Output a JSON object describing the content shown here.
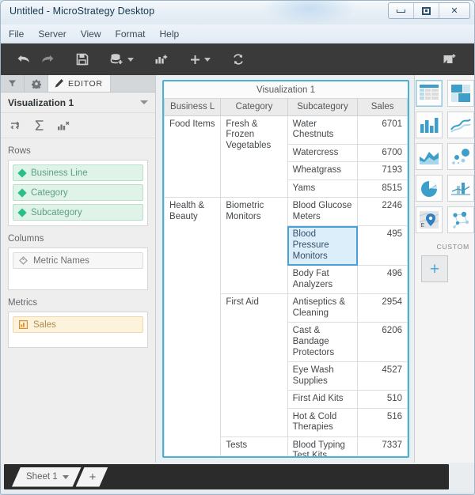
{
  "window": {
    "title": "Untitled - MicroStrategy Desktop",
    "controls": {
      "minimize": "minimize-icon",
      "restore": "restore-icon",
      "close": "✕"
    }
  },
  "menubar": {
    "items": [
      {
        "label": "File"
      },
      {
        "label": "Server"
      },
      {
        "label": "View"
      },
      {
        "label": "Format"
      },
      {
        "label": "Help"
      }
    ]
  },
  "toolbar": {
    "buttons": [
      {
        "name": "undo-icon",
        "glyph": "↰"
      },
      {
        "name": "redo-icon",
        "glyph": "↱"
      },
      {
        "name": "save-icon",
        "glyph": "save"
      },
      {
        "name": "add-data-icon",
        "glyph": "data",
        "has_caret": true
      },
      {
        "name": "add-visualization-icon",
        "glyph": "chart"
      },
      {
        "name": "add-icon",
        "glyph": "+",
        "has_caret": true
      },
      {
        "name": "refresh-icon",
        "glyph": "refresh"
      }
    ],
    "right_button": {
      "name": "add-panel-icon"
    }
  },
  "editor": {
    "tabs": [
      {
        "name": "filters-tab",
        "icon": "filter-icon",
        "label": ""
      },
      {
        "name": "properties-tab",
        "icon": "gear-icon",
        "label": ""
      },
      {
        "name": "editor-tab",
        "icon": "pencil-icon",
        "label": "EDITOR",
        "active": true
      }
    ],
    "visualization_name": "Visualization 1",
    "tools": [
      {
        "name": "swap-rows-columns-icon",
        "glyph": "swap"
      },
      {
        "name": "totals-icon",
        "glyph": "Σ"
      },
      {
        "name": "remove-all-icon",
        "glyph": "chart-x"
      }
    ],
    "zones": [
      {
        "name": "rows-zone",
        "label": "Rows",
        "items": [
          {
            "label": "Business Line",
            "kind": "attribute"
          },
          {
            "label": "Category",
            "kind": "attribute"
          },
          {
            "label": "Subcategory",
            "kind": "attribute"
          }
        ]
      },
      {
        "name": "columns-zone",
        "label": "Columns",
        "items": [
          {
            "label": "Metric Names",
            "kind": "neutral"
          }
        ]
      },
      {
        "name": "metrics-zone",
        "label": "Metrics",
        "items": [
          {
            "label": "Sales",
            "kind": "metric"
          }
        ]
      }
    ]
  },
  "visualization": {
    "title": "Visualization 1",
    "columns": [
      {
        "key": "business_line",
        "label": "Business L"
      },
      {
        "key": "category",
        "label": "Category"
      },
      {
        "key": "subcategory",
        "label": "Subcategory"
      },
      {
        "key": "sales",
        "label": "Sales"
      }
    ],
    "rows": [
      {
        "business_line": "Food Items",
        "bl_span": 4,
        "category": "Fresh & Frozen Vegetables",
        "cat_span": 4,
        "subcategory": "Water Chestnuts",
        "sales": "6701",
        "selected": false
      },
      {
        "subcategory": "Watercress",
        "sales": "6700",
        "selected": false
      },
      {
        "subcategory": "Wheatgrass",
        "sales": "7193",
        "selected": false
      },
      {
        "subcategory": "Yams",
        "sales": "8515",
        "selected": false
      },
      {
        "business_line": "Health & Beauty",
        "bl_span": 9,
        "category": "Biometric Monitors",
        "cat_span": 3,
        "subcategory": "Blood Glucose Meters",
        "sales": "2246",
        "selected": false
      },
      {
        "subcategory": "Blood Pressure Monitors",
        "sales": "495",
        "selected": true
      },
      {
        "subcategory": "Body Fat Analyzers",
        "sales": "496",
        "selected": false
      },
      {
        "category": "First Aid",
        "cat_span": 5,
        "subcategory": "Antiseptics & Cleaning",
        "sales": "2954",
        "selected": false
      },
      {
        "subcategory": "Cast & Bandage Protectors",
        "sales": "6206",
        "selected": false
      },
      {
        "subcategory": "Eye Wash Supplies",
        "sales": "4527",
        "selected": false
      },
      {
        "subcategory": "First Aid Kits",
        "sales": "510",
        "selected": false
      },
      {
        "subcategory": "Hot & Cold Therapies",
        "sales": "516",
        "selected": false
      },
      {
        "category": "Tests",
        "cat_span": 1,
        "subcategory": "Blood Typing Test Kits",
        "sales": "7337",
        "selected": false
      }
    ]
  },
  "gallery": {
    "thumbnails": [
      {
        "name": "grid-visualization-thumb",
        "type": "grid",
        "active": true
      },
      {
        "name": "heatmap-visualization-thumb",
        "type": "heatmap"
      },
      {
        "name": "bar-chart-visualization-thumb",
        "type": "bar"
      },
      {
        "name": "line-chart-visualization-thumb",
        "type": "line"
      },
      {
        "name": "area-chart-visualization-thumb",
        "type": "area"
      },
      {
        "name": "bubble-chart-visualization-thumb",
        "type": "bubble"
      },
      {
        "name": "pie-chart-visualization-thumb",
        "type": "pie"
      },
      {
        "name": "combo-chart-visualization-thumb",
        "type": "combo"
      },
      {
        "name": "map-visualization-thumb",
        "type": "map"
      },
      {
        "name": "network-visualization-thumb",
        "type": "network"
      }
    ],
    "custom_label": "CUSTOM",
    "add_label": "+"
  },
  "sheetbar": {
    "sheet_label": "Sheet 1",
    "add_label": "+"
  }
}
